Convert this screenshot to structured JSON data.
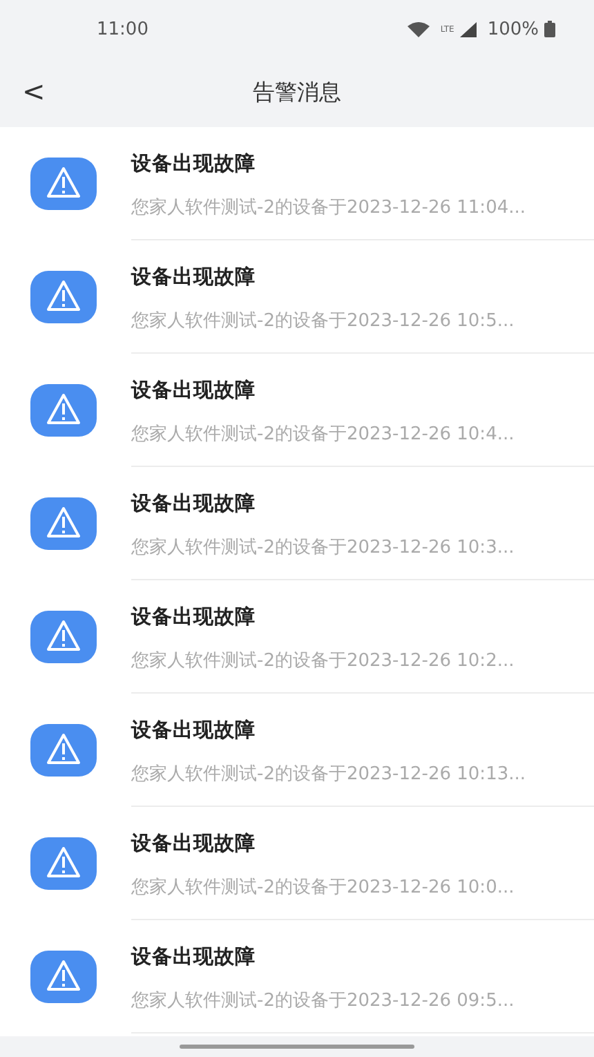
{
  "status_bar": {
    "time": "11:00",
    "network": "LTE",
    "battery": "100%"
  },
  "header": {
    "back": "<",
    "title": "告警消息"
  },
  "alerts": [
    {
      "title": "设备出现故障",
      "message": "您家人软件测试-2的设备于2023-12-26 11:04..."
    },
    {
      "title": "设备出现故障",
      "message": "您家人软件测试-2的设备于2023-12-26 10:5..."
    },
    {
      "title": "设备出现故障",
      "message": "您家人软件测试-2的设备于2023-12-26 10:4..."
    },
    {
      "title": "设备出现故障",
      "message": "您家人软件测试-2的设备于2023-12-26 10:3..."
    },
    {
      "title": "设备出现故障",
      "message": "您家人软件测试-2的设备于2023-12-26 10:2..."
    },
    {
      "title": "设备出现故障",
      "message": "您家人软件测试-2的设备于2023-12-26 10:13..."
    },
    {
      "title": "设备出现故障",
      "message": "您家人软件测试-2的设备于2023-12-26 10:0..."
    },
    {
      "title": "设备出现故障",
      "message": "您家人软件测试-2的设备于2023-12-26 09:5..."
    }
  ]
}
